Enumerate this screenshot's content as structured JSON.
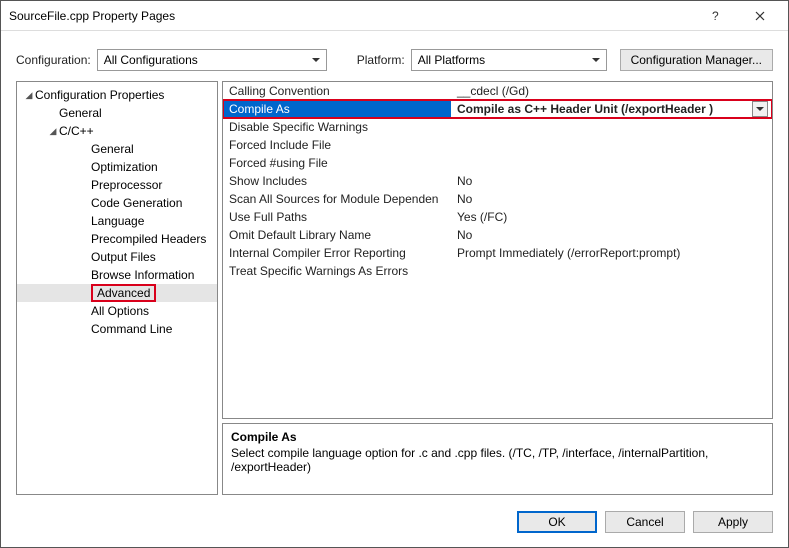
{
  "titlebar": {
    "title": "SourceFile.cpp Property Pages"
  },
  "config": {
    "label": "Configuration:",
    "value": "All Configurations",
    "platform_label": "Platform:",
    "platform_value": "All Platforms",
    "manager_btn": "Configuration Manager..."
  },
  "tree": {
    "root": "Configuration Properties",
    "general": "General",
    "cpp": "C/C++",
    "items": {
      "general2": "General",
      "optimization": "Optimization",
      "preprocessor": "Preprocessor",
      "codegen": "Code Generation",
      "language": "Language",
      "pch": "Precompiled Headers",
      "outputfiles": "Output Files",
      "browseinfo": "Browse Information",
      "advanced": "Advanced",
      "alloptions": "All Options",
      "cmdline": "Command Line"
    }
  },
  "grid": {
    "calling_convention": {
      "n": "Calling Convention",
      "v": "__cdecl (/Gd)"
    },
    "compile_as": {
      "n": "Compile As",
      "v": "Compile as C++ Header Unit (/exportHeader )"
    },
    "disable_warn": {
      "n": "Disable Specific Warnings",
      "v": ""
    },
    "forced_incl": {
      "n": "Forced Include File",
      "v": ""
    },
    "forced_using": {
      "n": "Forced #using File",
      "v": ""
    },
    "show_incl": {
      "n": "Show Includes",
      "v": "No"
    },
    "scan_all": {
      "n": "Scan All Sources for Module Dependen",
      "v": "No"
    },
    "full_paths": {
      "n": "Use Full Paths",
      "v": "Yes (/FC)"
    },
    "omit_lib": {
      "n": "Omit Default Library Name",
      "v": "No"
    },
    "ice_report": {
      "n": "Internal Compiler Error Reporting",
      "v": "Prompt Immediately (/errorReport:prompt)"
    },
    "warn_err": {
      "n": "Treat Specific Warnings As Errors",
      "v": ""
    }
  },
  "desc": {
    "title": "Compile As",
    "text": "Select compile language option for .c and .cpp files.    (/TC, /TP, /interface, /internalPartition, /exportHeader)"
  },
  "footer": {
    "ok": "OK",
    "cancel": "Cancel",
    "apply": "Apply"
  }
}
